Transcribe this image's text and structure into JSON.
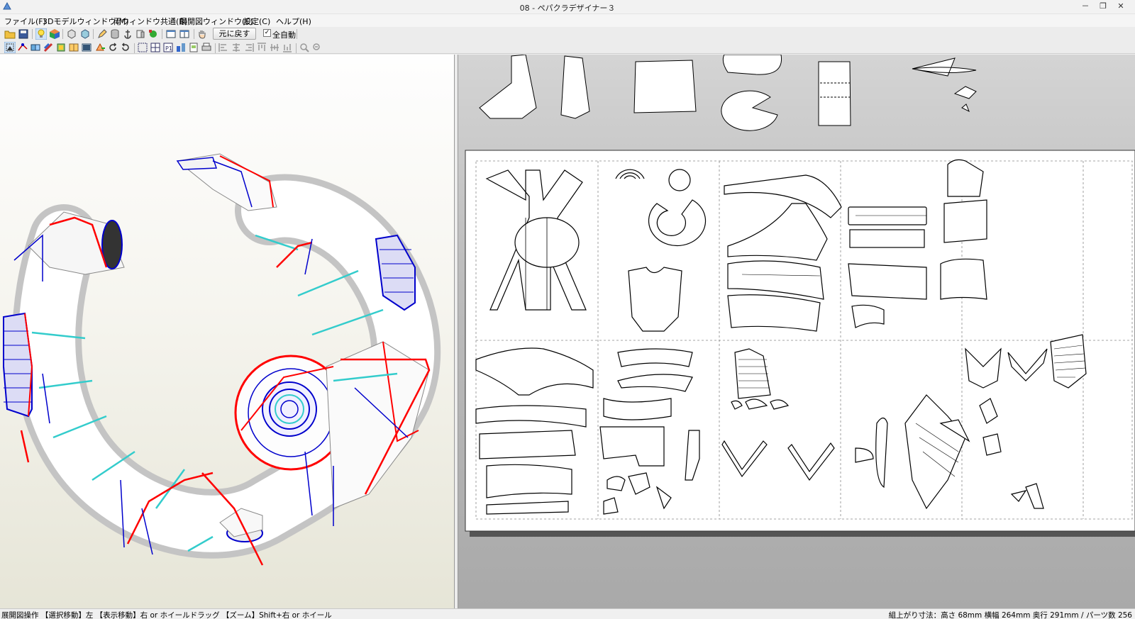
{
  "window": {
    "title": "08 - ペパクラデザイナー３",
    "minimize": "－",
    "restore": "❐",
    "close": "✕"
  },
  "menu": [
    {
      "label": "ファイル(F)"
    },
    {
      "label": "3Dモデルウィンドウ(M)"
    },
    {
      "label": "両ウィンドウ共通(B)"
    },
    {
      "label": "展開図ウィンドウ(E)"
    },
    {
      "label": "設定(C)"
    },
    {
      "label": "ヘルプ(H)"
    }
  ],
  "toolbar": {
    "undo_label": "元に戻す",
    "auto_label": "全自動",
    "auto_checked": true,
    "auto_check_mark": "✓"
  },
  "status": {
    "left": "展開図操作 【選択移動】左 【表示移動】右 or ホイールドラッグ 【ズーム】Shift+右 or ホイール",
    "right": "組上がり寸法：高さ 68mm 横幅 264mm 奥行 291mm / パーツ数 256"
  },
  "colors": {
    "fold_mountain": "#ff0000",
    "fold_valley": "#0000cc",
    "seam": "#33cccc"
  }
}
